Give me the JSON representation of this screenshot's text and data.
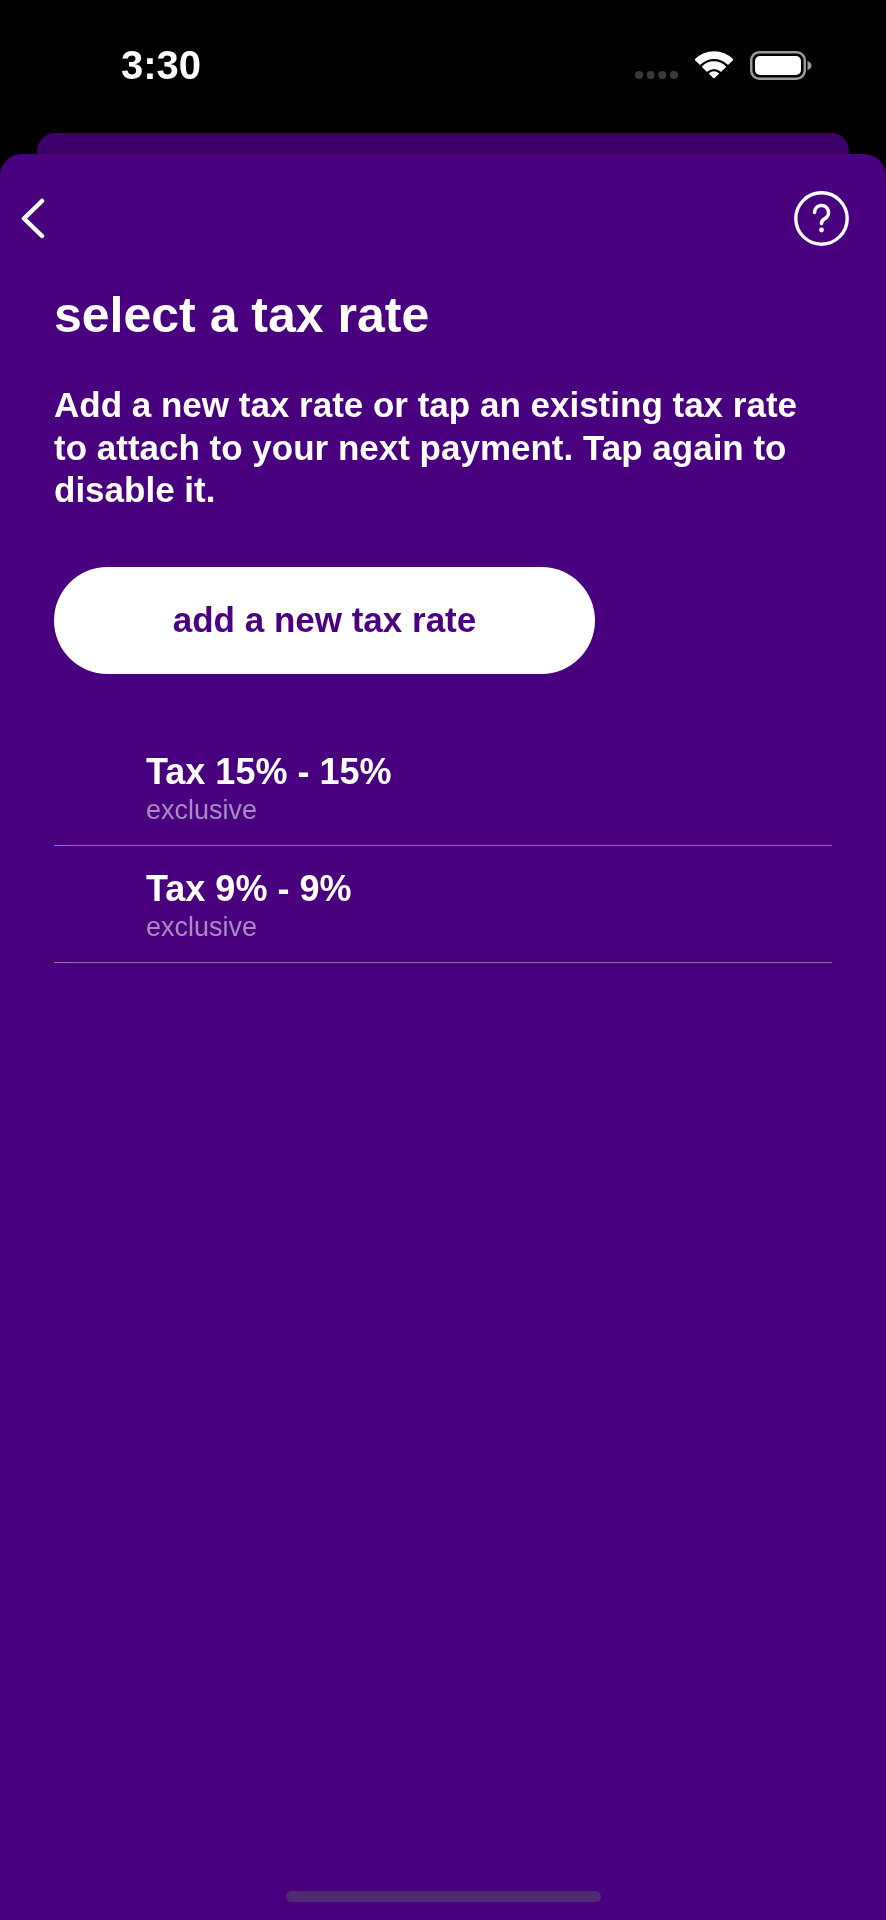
{
  "status_bar": {
    "time": "3:30"
  },
  "header": {
    "title": "select a tax rate",
    "description": "Add a new tax rate or tap an existing tax rate to attach to your next payment. Tap again to disable it."
  },
  "add_button": {
    "label": "add a new tax rate"
  },
  "tax_rates": [
    {
      "name": "Tax 15% - 15%",
      "subtitle": "exclusive",
      "selected": false
    },
    {
      "name": "Tax 9% - 9%",
      "subtitle": "exclusive",
      "selected": false
    }
  ]
}
